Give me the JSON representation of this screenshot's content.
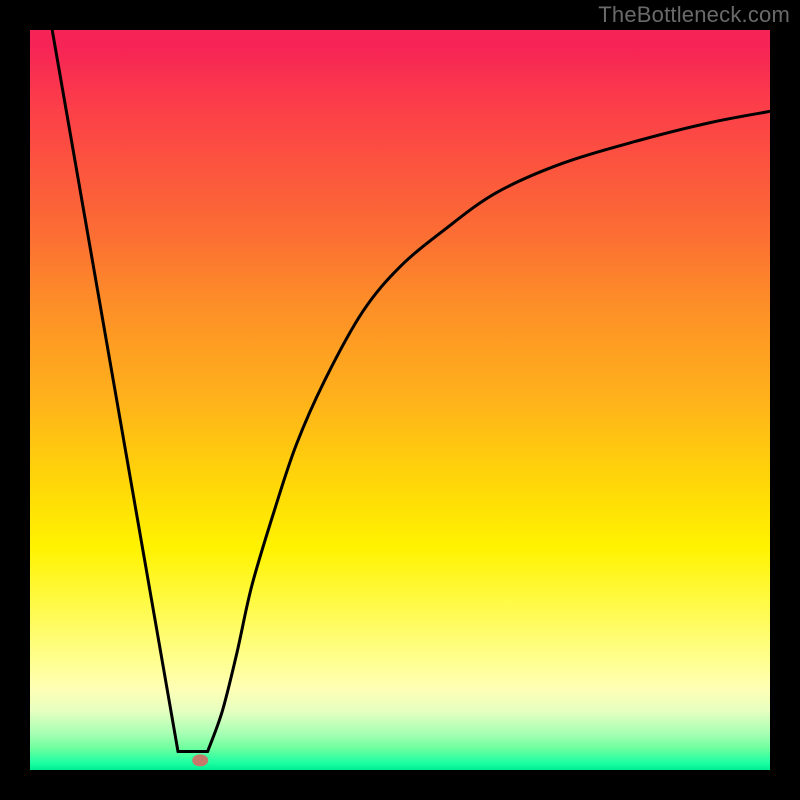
{
  "watermark": "TheBottleneck.com",
  "chart_data": {
    "type": "line",
    "title": "",
    "xlabel": "",
    "ylabel": "",
    "xlim": [
      0,
      100
    ],
    "ylim": [
      0,
      100
    ],
    "grid": false,
    "series": [
      {
        "name": "left-segment",
        "x": [
          3,
          20
        ],
        "y": [
          100,
          2.5
        ]
      },
      {
        "name": "flat-segment",
        "x": [
          20,
          24
        ],
        "y": [
          2.5,
          2.5
        ]
      },
      {
        "name": "right-curve",
        "x": [
          24,
          26,
          28,
          30,
          33,
          36,
          40,
          45,
          50,
          56,
          63,
          72,
          82,
          92,
          100
        ],
        "y": [
          2.5,
          8,
          16,
          25,
          35,
          44,
          53,
          62,
          68,
          73,
          78,
          82,
          85,
          87.5,
          89
        ]
      }
    ],
    "marker": {
      "x": 23,
      "y": 1.3
    },
    "background_gradient": {
      "stops": [
        {
          "pct": 0,
          "color": "#f62357"
        },
        {
          "pct": 10,
          "color": "#fc3d49"
        },
        {
          "pct": 28,
          "color": "#fc6f33"
        },
        {
          "pct": 50,
          "color": "#ffb21b"
        },
        {
          "pct": 70,
          "color": "#fff300"
        },
        {
          "pct": 85,
          "color": "#ffff8e"
        },
        {
          "pct": 95,
          "color": "#a8ffb4"
        },
        {
          "pct": 100,
          "color": "#00ed92"
        }
      ]
    }
  }
}
